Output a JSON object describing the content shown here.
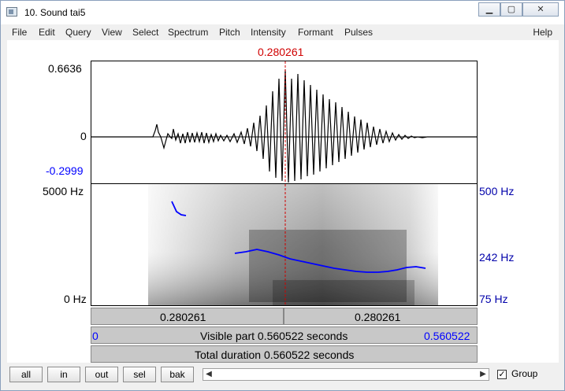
{
  "window": {
    "title": "10. Sound tai5",
    "icons": [
      "minimize-icon",
      "maximize-icon",
      "close-icon"
    ]
  },
  "menu": [
    "File",
    "Edit",
    "Query",
    "View",
    "Select",
    "Spectrum",
    "Pitch",
    "Intensity",
    "Formant",
    "Pulses"
  ],
  "help": "Help",
  "cursor": {
    "time": "0.280261",
    "color": "#d00000"
  },
  "waveform": {
    "ymax": "0.6636",
    "ymid": "0",
    "ymin": "-0.2999"
  },
  "spectrogram": {
    "left_top": "5000 Hz",
    "left_bottom": "0 Hz",
    "right_top": "500 Hz",
    "right_mid": "242 Hz",
    "right_bottom": "75 Hz",
    "pitch_color": "#0000ff"
  },
  "time_bars": {
    "left_segment": "0.280261",
    "right_segment": "0.280261",
    "start": "0",
    "visible_part": "Visible part 0.560522 seconds",
    "end": "0.560522",
    "total_duration": "Total duration 0.560522 seconds"
  },
  "buttons": {
    "all": "all",
    "in": "in",
    "out": "out",
    "sel": "sel",
    "bak": "bak"
  },
  "group": {
    "label": "Group",
    "checked": true
  }
}
